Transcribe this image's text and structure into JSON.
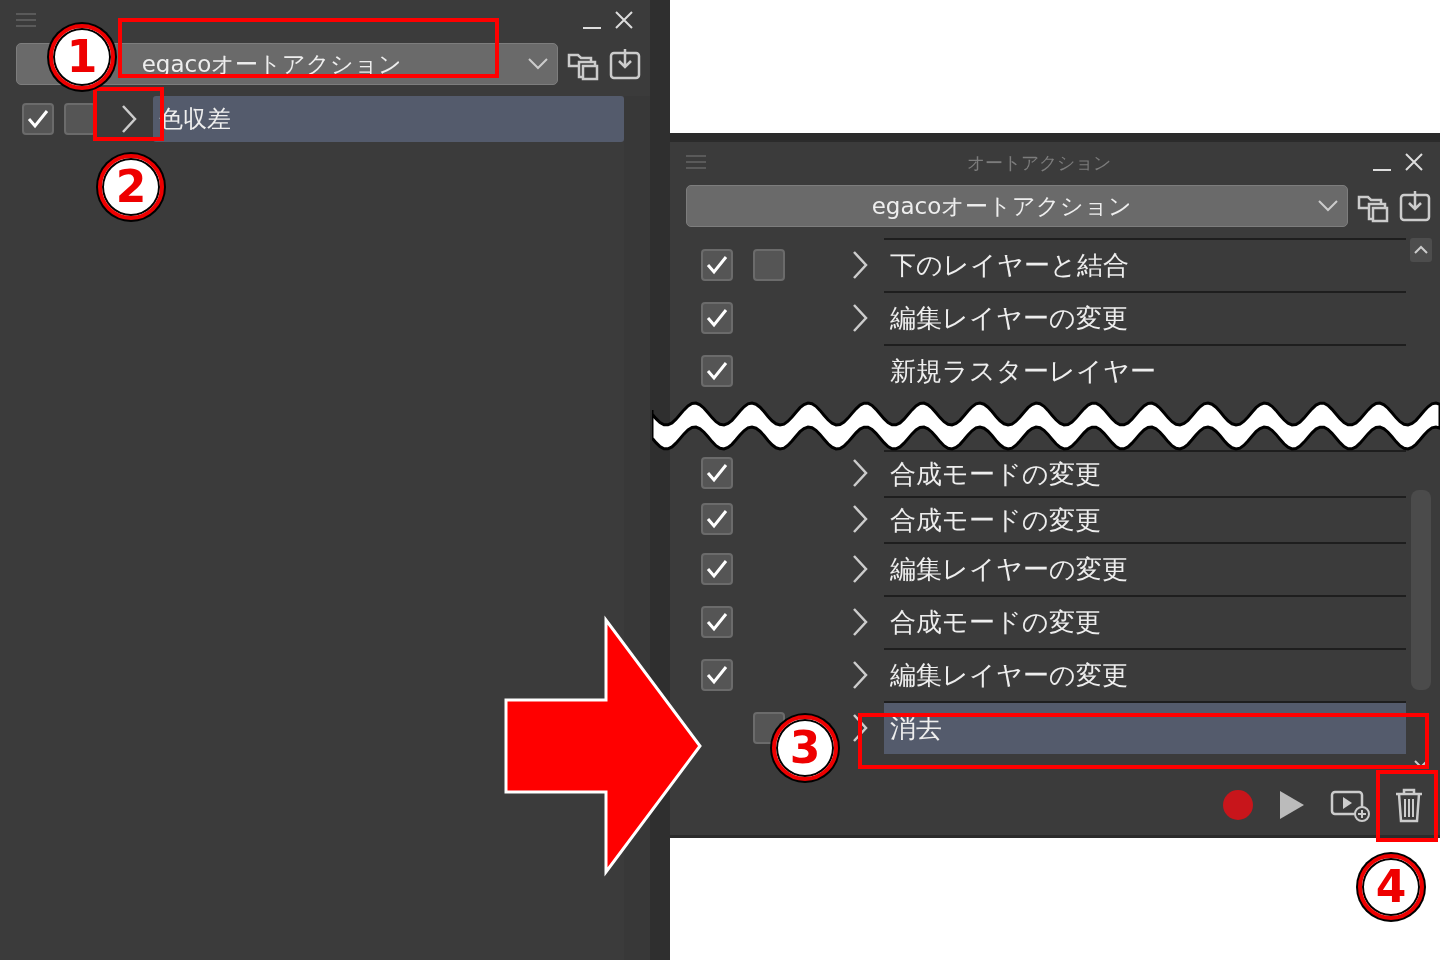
{
  "left_panel": {
    "set_dropdown": {
      "value": "egacoオートアクション"
    },
    "actions": [
      {
        "label": "色収差",
        "checked": true,
        "has_dialog_toggle": true,
        "dialog_checked": false,
        "expandable": true,
        "selected": true
      }
    ]
  },
  "right_panel": {
    "title": "オートアクション",
    "set_dropdown": {
      "value": "egacoオートアクション"
    },
    "actions_top": [
      {
        "label": "下のレイヤーと結合",
        "checked": true,
        "has_dialog_toggle": true,
        "dialog_checked": false,
        "expandable": true,
        "selected": false
      },
      {
        "label": "編集レイヤーの変更",
        "checked": true,
        "has_dialog_toggle": false,
        "expandable": true,
        "selected": false
      },
      {
        "label": "新規ラスターレイヤー",
        "checked": true,
        "has_dialog_toggle": false,
        "expandable": false,
        "selected": false
      }
    ],
    "actions_bottom": [
      {
        "label": "合成モードの変更",
        "checked": true,
        "has_dialog_toggle": false,
        "expandable": true,
        "selected": false
      },
      {
        "label": "合成モードの変更",
        "checked": true,
        "has_dialog_toggle": false,
        "expandable": true,
        "selected": false
      },
      {
        "label": "編集レイヤーの変更",
        "checked": true,
        "has_dialog_toggle": false,
        "expandable": true,
        "selected": false
      },
      {
        "label": "合成モードの変更",
        "checked": true,
        "has_dialog_toggle": false,
        "expandable": true,
        "selected": false
      },
      {
        "label": "編集レイヤーの変更",
        "checked": true,
        "has_dialog_toggle": false,
        "expandable": true,
        "selected": false
      },
      {
        "label": "消去",
        "has_dialog_toggle": true,
        "dialog_checked": false,
        "expandable": true,
        "selected": true
      }
    ]
  },
  "callouts": [
    {
      "number": "1"
    },
    {
      "number": "2"
    },
    {
      "number": "3"
    },
    {
      "number": "4"
    }
  ]
}
